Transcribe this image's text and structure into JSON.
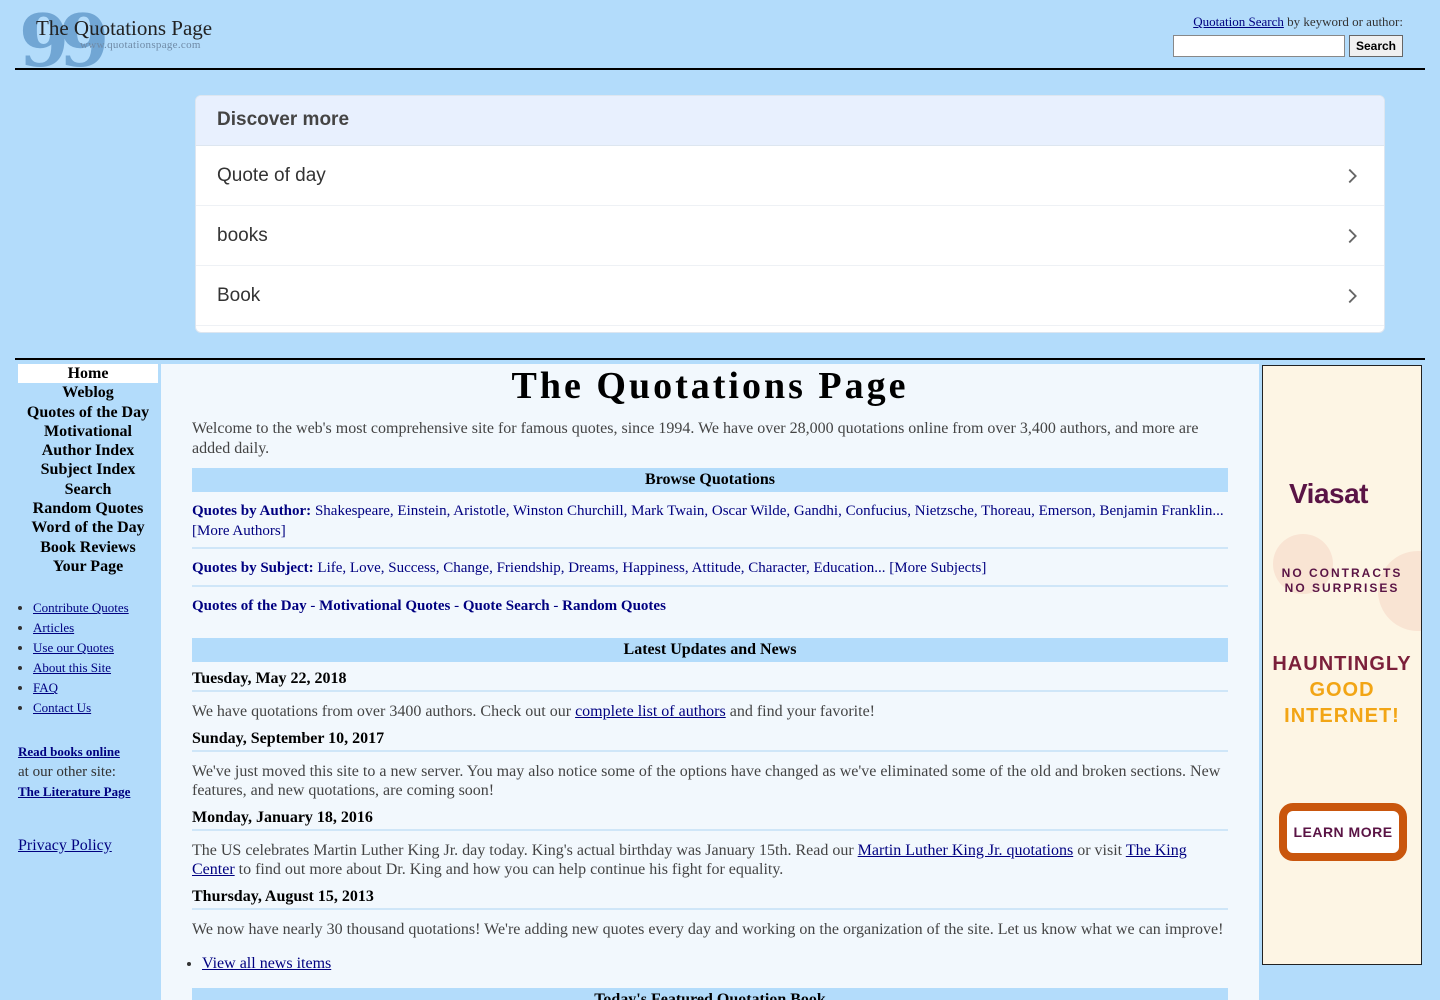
{
  "header": {
    "logo_title": "The Quotations Page",
    "logo_url": "www.quotationspage.com",
    "search_link": "Quotation Search",
    "search_caption_rest": " by keyword or author:",
    "search_value": "",
    "search_button": "Search"
  },
  "discover": {
    "title": "Discover more",
    "items": [
      {
        "label": "Quote of day"
      },
      {
        "label": "books"
      },
      {
        "label": "Book"
      }
    ]
  },
  "nav": {
    "items": [
      {
        "label": "Home"
      },
      {
        "label": "Weblog"
      },
      {
        "label": "Quotes of the Day"
      },
      {
        "label": "Motivational"
      },
      {
        "label": "Author Index"
      },
      {
        "label": "Subject Index"
      },
      {
        "label": "Search"
      },
      {
        "label": "Random Quotes"
      },
      {
        "label": "Word of the Day"
      },
      {
        "label": "Book Reviews"
      },
      {
        "label": "Your Page"
      }
    ],
    "sub_links": [
      {
        "label": "Contribute Quotes"
      },
      {
        "label": "Articles"
      },
      {
        "label": "Use our Quotes"
      },
      {
        "label": "About this Site"
      },
      {
        "label": "FAQ"
      },
      {
        "label": "Contact Us"
      }
    ],
    "read_books": "Read books online",
    "other_site": "at our other site:",
    "literature": "The Literature Page",
    "privacy": "Privacy Policy"
  },
  "content": {
    "title": "The Quotations Page",
    "welcome": "Welcome to the web's most comprehensive site for famous quotes, since 1994. We have over 28,000 quotations online from over 3,400 authors, and more are added daily.",
    "browse_title": "Browse Quotations",
    "by_author_label": "Quotes by Author:",
    "authors": [
      "Shakespeare",
      "Einstein",
      "Aristotle",
      "Winston Churchill",
      "Mark Twain",
      "Oscar Wilde",
      "Gandhi",
      "Confucius",
      "Nietzsche",
      "Thoreau",
      "Emerson",
      "Benjamin Franklin..."
    ],
    "more_authors": "[More Authors]",
    "by_subject_label": "Quotes by Subject:",
    "subjects": [
      "Life",
      "Love",
      "Success",
      "Change",
      "Friendship",
      "Dreams",
      "Happiness",
      "Attitude",
      "Character",
      "Education..."
    ],
    "more_subjects": "[More Subjects]",
    "quick_links": [
      "Quotes of the Day",
      "Motivational Quotes",
      "Quote Search",
      "Random Quotes"
    ],
    "news_title": "Latest Updates and News",
    "news": [
      {
        "date": "Tuesday, May 22, 2018",
        "pre": "We have quotations from over 3400 authors. Check out our ",
        "link": "complete list of authors",
        "post": " and find your favorite!"
      },
      {
        "date": "Sunday, September 10, 2017",
        "text": "We've just moved this site to a new server. You may also notice some of the options have changed as we've eliminated some of the old and broken sections. New features, and new quotations, are coming soon!"
      },
      {
        "date": "Monday, January 18, 2016",
        "pre": "The US celebrates Martin Luther King Jr. day today. King's actual birthday was January 15th. Read our ",
        "link": "Martin Luther King Jr. quotations",
        "mid": " or visit ",
        "link2": "The King Center",
        "post": " to find out more about Dr. King and how you can help continue his fight for equality."
      },
      {
        "date": "Thursday, August 15, 2013",
        "text": "We now have nearly 30 thousand quotations! We're adding new quotes every day and working on the organization of the site. Let us know what we can improve!"
      }
    ],
    "view_all": "View all news items",
    "featured_title": "Today's Featured Quotation Book"
  },
  "ad": {
    "brand": "Viasat",
    "tag_line1": "NO CONTRACTS",
    "tag_line2": "NO SURPRISES",
    "headline1": "HAUNTINGLY",
    "headline2": "GOOD",
    "headline3": "INTERNET!",
    "cta": "LEARN MORE",
    "colors": {
      "brand": "#5a1445",
      "accent": "#f2a515",
      "button_border": "#c9560d"
    }
  }
}
